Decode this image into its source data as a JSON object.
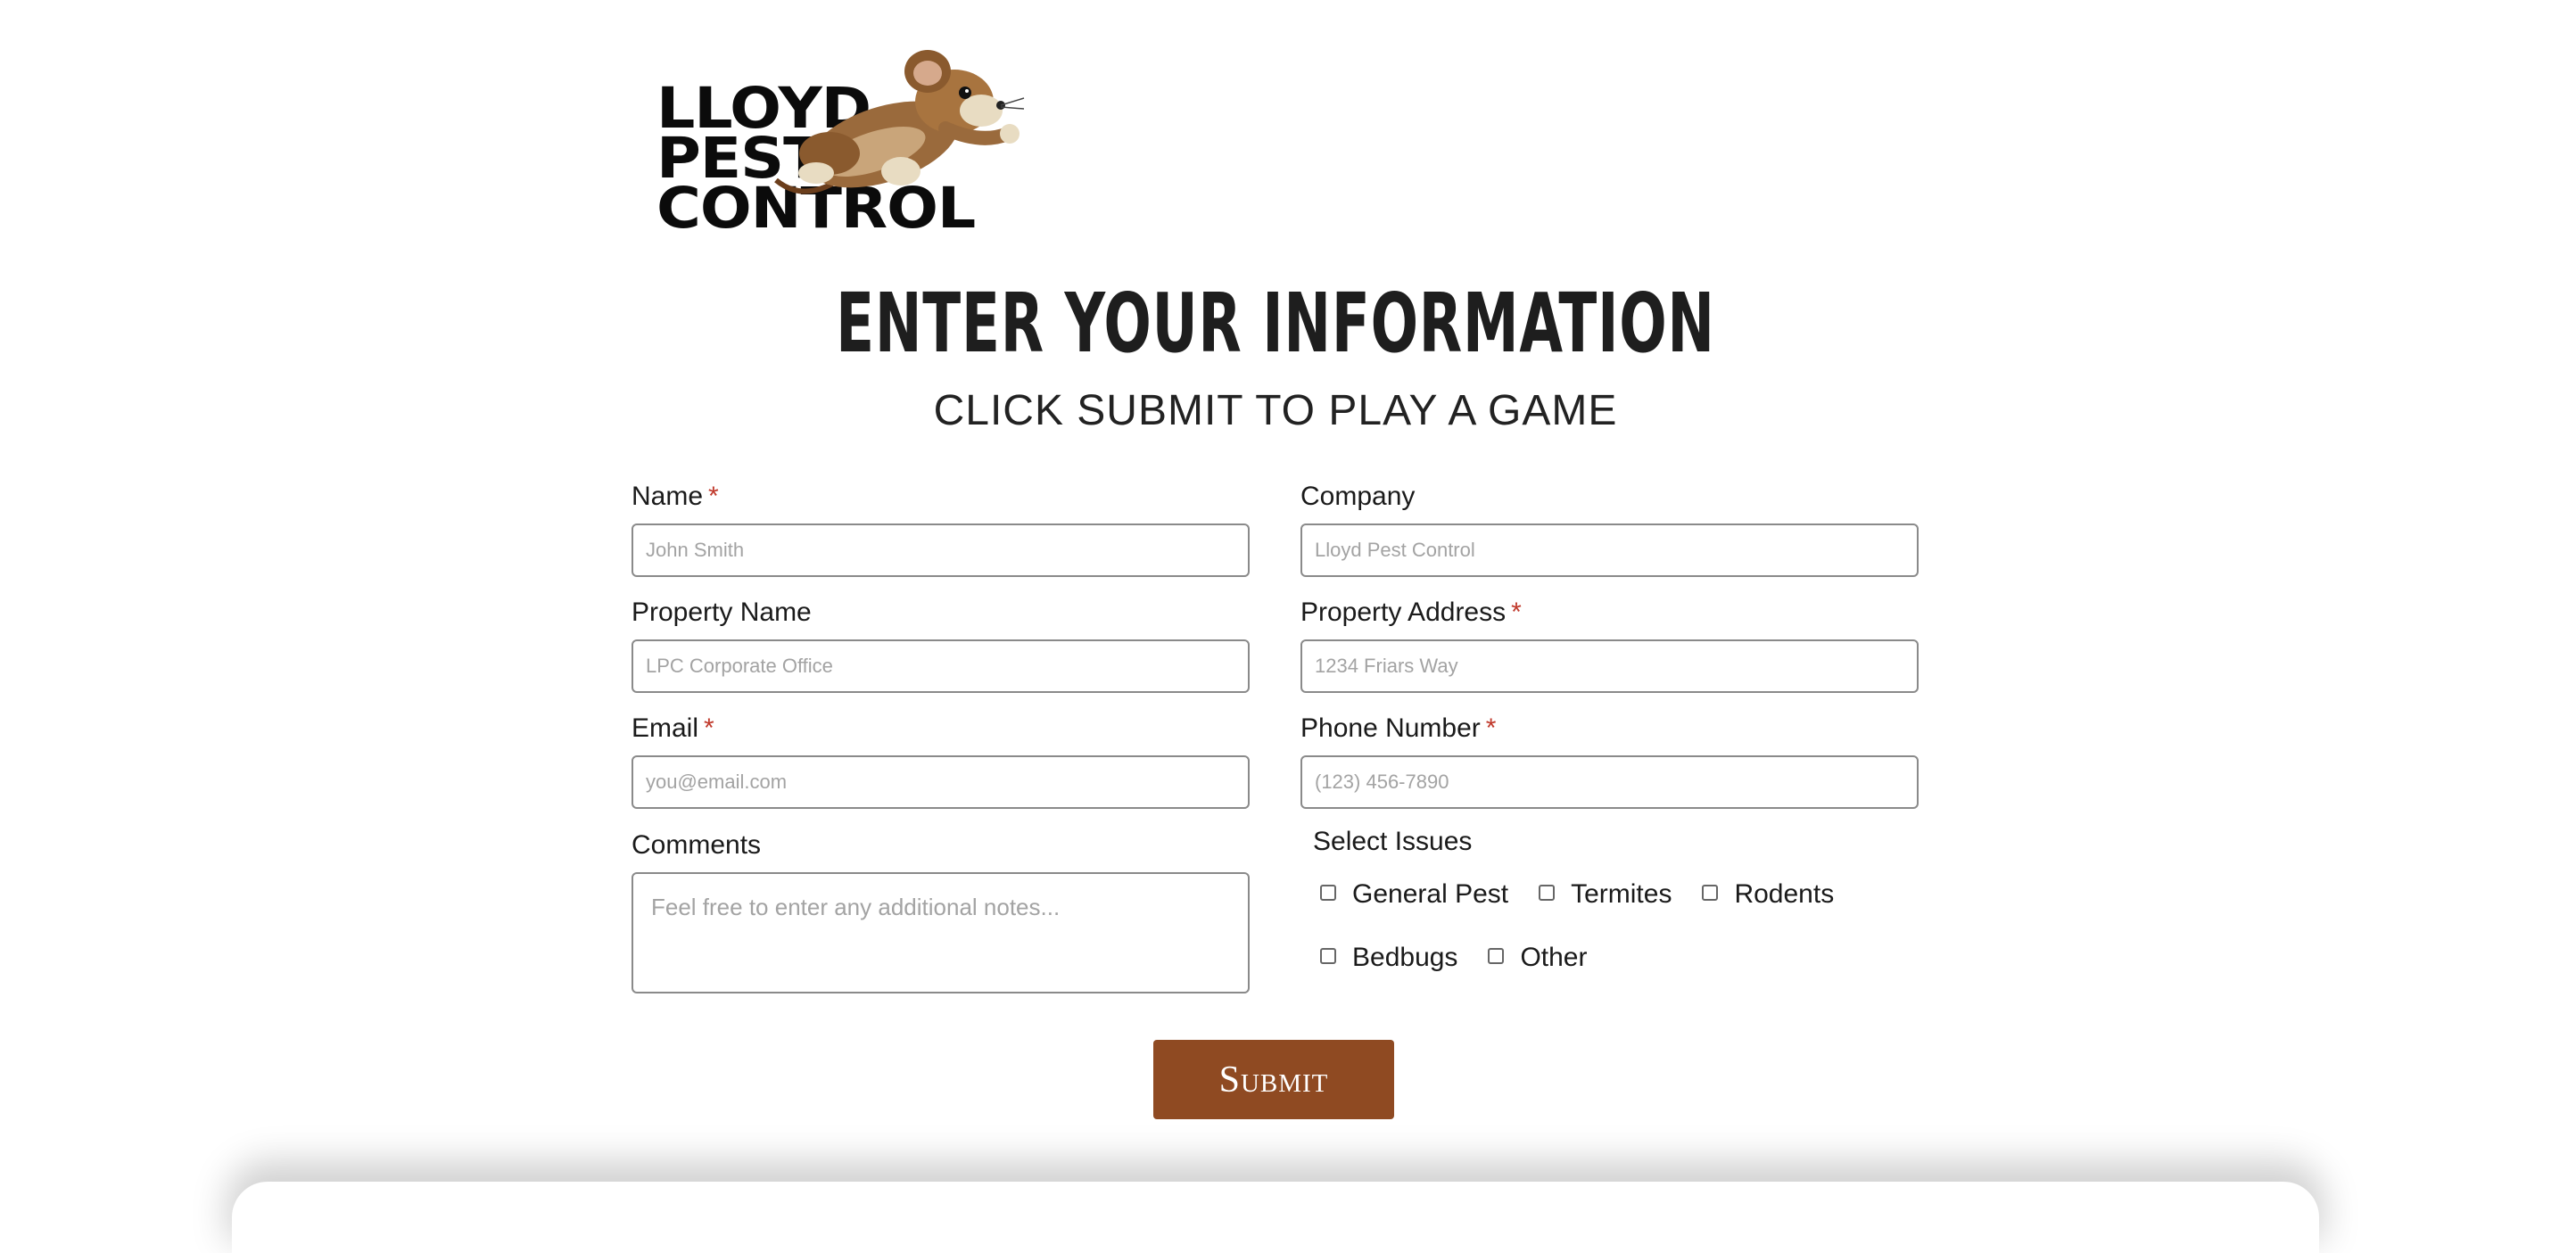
{
  "logo": {
    "line1": "LLOYD",
    "line2": "PEST",
    "line3": "CONTROL",
    "mascot_icon": "mouse-mascot-icon"
  },
  "header": {
    "title": "ENTER YOUR INFORMATION",
    "subtitle": "CLICK SUBMIT TO PLAY A GAME"
  },
  "form": {
    "name": {
      "label": "Name",
      "required_mark": "*",
      "placeholder": "John Smith"
    },
    "company": {
      "label": "Company",
      "placeholder": "Lloyd Pest Control"
    },
    "property_name": {
      "label": "Property Name",
      "placeholder": "LPC Corporate Office"
    },
    "property_address": {
      "label": "Property Address",
      "required_mark": "*",
      "placeholder": "1234 Friars Way"
    },
    "email": {
      "label": "Email",
      "required_mark": "*",
      "placeholder": "you@email.com"
    },
    "phone": {
      "label": "Phone Number",
      "required_mark": "*",
      "placeholder": "(123) 456-7890"
    },
    "comments": {
      "label": "Comments",
      "placeholder": "Feel free to enter any additional notes..."
    },
    "issues": {
      "label": "Select Issues",
      "options": [
        "General Pest",
        "Termites",
        "Rodents",
        "Bedbugs",
        "Other"
      ]
    },
    "submit_label": "Submit"
  },
  "colors": {
    "submit_bg": "#8f4a22",
    "required": "#c0392b"
  }
}
